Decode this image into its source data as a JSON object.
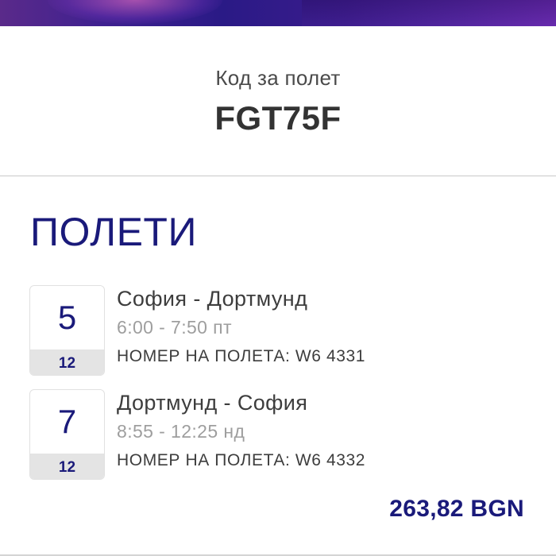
{
  "booking": {
    "code_label": "Код за полет",
    "code": "FGT75F"
  },
  "flights_section": {
    "heading": "ПОЛЕТИ",
    "flights": [
      {
        "day": "5",
        "month": "12",
        "route": "София - Дортмунд",
        "time": "6:00 - 7:50 пт",
        "flight_number": "НОМЕР НА ПОЛЕТА: W6 4331"
      },
      {
        "day": "7",
        "month": "12",
        "route": "Дортмунд - София",
        "time": "8:55 - 12:25 нд",
        "flight_number": "НОМЕР НА ПОЛЕТА: W6 4332"
      }
    ]
  },
  "total": {
    "price": "263,82 BGN"
  },
  "colors": {
    "brand_navy": "#1a1a7a",
    "banner_purple": "#3f2190",
    "muted_text": "#9e9e9e",
    "tile_month_bg": "#e4e4e4"
  }
}
